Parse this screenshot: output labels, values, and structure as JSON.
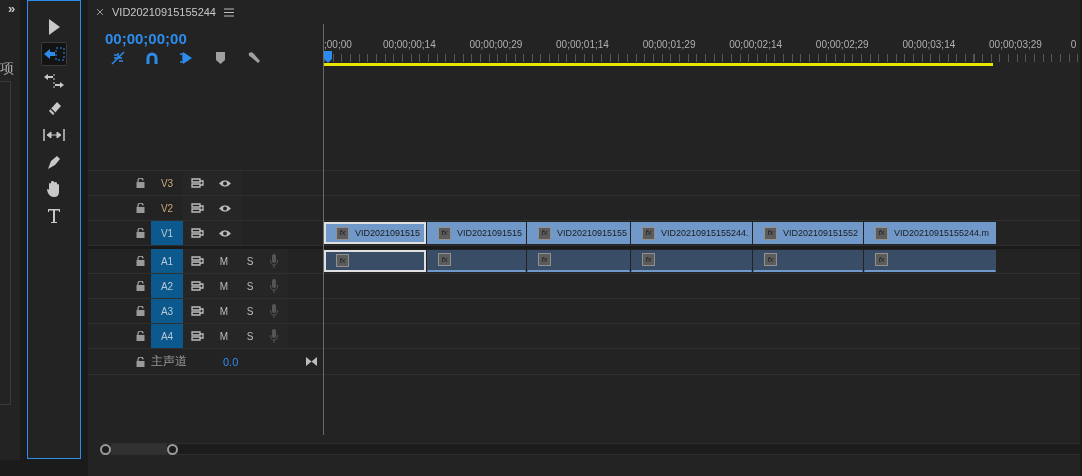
{
  "left_panel": {
    "toggle": "»",
    "label": "项"
  },
  "tools": [
    {
      "kind": "select",
      "selected": false
    },
    {
      "kind": "track-select",
      "selected": true
    },
    {
      "kind": "ripple",
      "selected": false
    },
    {
      "kind": "razor",
      "selected": false
    },
    {
      "kind": "slip",
      "selected": false
    },
    {
      "kind": "pen",
      "selected": false
    },
    {
      "kind": "hand",
      "selected": false
    },
    {
      "kind": "type",
      "selected": false
    }
  ],
  "sequence": {
    "title": "VID20210915155244",
    "timecode": "00;00;00;00"
  },
  "toolbar": [
    {
      "kind": "nest",
      "on": true
    },
    {
      "kind": "snap",
      "on": true
    },
    {
      "kind": "linked",
      "on": true
    },
    {
      "kind": "marker",
      "on": false
    },
    {
      "kind": "settings",
      "on": false
    }
  ],
  "ruler": {
    "labels": [
      ";00;00",
      "00;00;00;14",
      "00;00;00;29",
      "00;00;01;14",
      "00;00;01;29",
      "00;00;02;14",
      "00;00;02;29",
      "00;00;03;14",
      "00;00;03;29",
      "0"
    ],
    "work_area": {
      "level": 0.885
    }
  },
  "video_tracks": [
    {
      "name": "V3",
      "targeted": false
    },
    {
      "name": "V2",
      "targeted": false
    },
    {
      "name": "V1",
      "targeted": true
    }
  ],
  "audio_tracks": [
    {
      "name": "A1",
      "targeted": true,
      "mute": "M",
      "solo": "S"
    },
    {
      "name": "A2",
      "targeted": true,
      "mute": "M",
      "solo": "S"
    },
    {
      "name": "A3",
      "targeted": true,
      "mute": "M",
      "solo": "S"
    },
    {
      "name": "A4",
      "targeted": true,
      "mute": "M",
      "solo": "S"
    }
  ],
  "master": {
    "name": "主声道",
    "value": "0.0"
  },
  "video_clips": [
    {
      "name": "VID2021091515",
      "badge": "fx",
      "selected": true
    },
    {
      "name": "VID2021091515",
      "badge": "fx",
      "selected": false
    },
    {
      "name": "VID20210915155",
      "badge": "fx",
      "selected": false
    },
    {
      "name": "VID20210915155244.",
      "badge": "fx",
      "selected": false
    },
    {
      "name": "VID202109151552",
      "badge": "fx",
      "selected": false
    },
    {
      "name": "VID20210915155244.m",
      "badge": "fx",
      "selected": false
    }
  ],
  "audio_clips": [
    {
      "badge": "fx",
      "selected": true
    },
    {
      "badge": "fx",
      "selected": false
    },
    {
      "badge": "fx",
      "selected": false
    },
    {
      "badge": "fx",
      "selected": false
    },
    {
      "badge": "fx",
      "selected": false
    },
    {
      "badge": "fx",
      "selected": false
    }
  ]
}
